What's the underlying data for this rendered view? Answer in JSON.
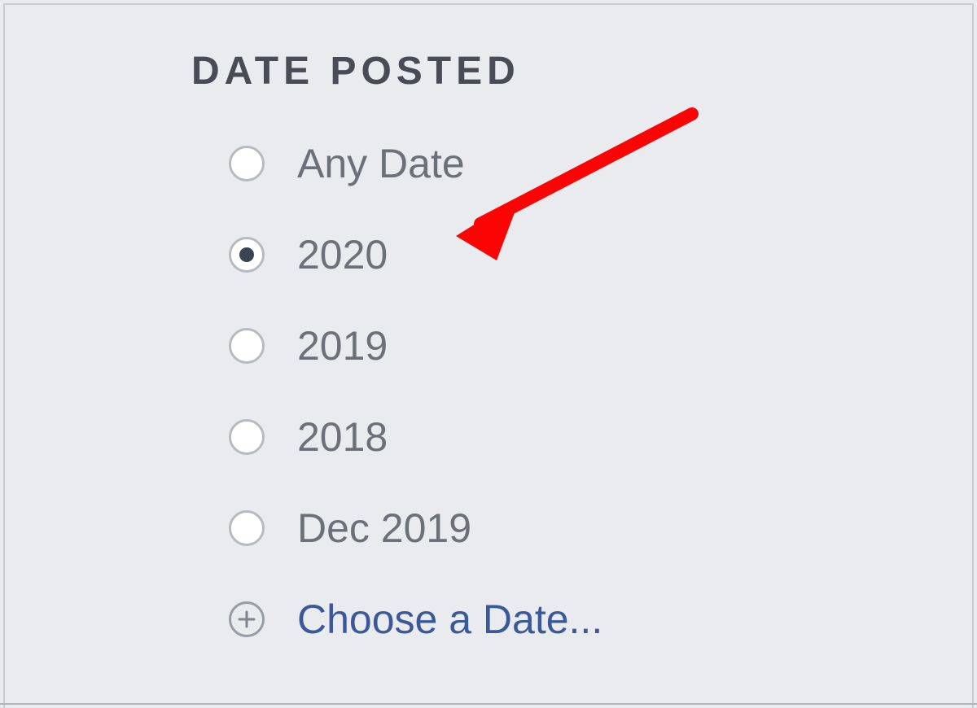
{
  "filter": {
    "heading": "DATE POSTED",
    "options": [
      {
        "label": "Any Date",
        "selected": false
      },
      {
        "label": "2020",
        "selected": true
      },
      {
        "label": "2019",
        "selected": false
      },
      {
        "label": "2018",
        "selected": false
      },
      {
        "label": "Dec 2019",
        "selected": false
      }
    ],
    "choose_label": "Choose a Date..."
  },
  "annotation": {
    "arrow_color": "#fc0404"
  }
}
